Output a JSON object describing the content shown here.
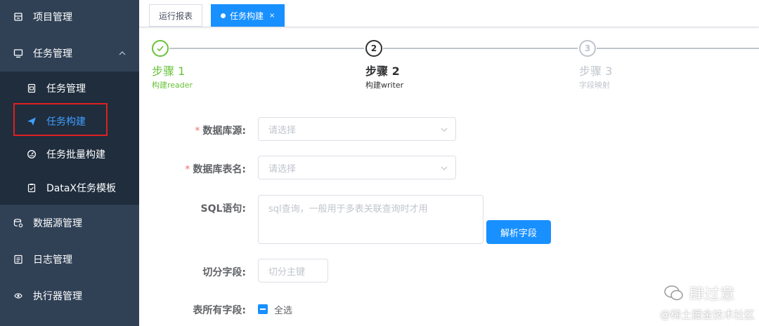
{
  "sidebar": {
    "items": [
      {
        "label": "项目管理",
        "icon": "project-icon"
      },
      {
        "label": "任务管理",
        "icon": "monitor-icon"
      },
      {
        "label": "数据源管理",
        "icon": "database-icon"
      },
      {
        "label": "日志管理",
        "icon": "log-icon"
      },
      {
        "label": "执行器管理",
        "icon": "executor-icon"
      }
    ],
    "sub_items": [
      {
        "label": "任务管理",
        "icon": "task-icon"
      },
      {
        "label": "任务构建",
        "icon": "send-icon"
      },
      {
        "label": "任务批量构建",
        "icon": "batch-icon"
      },
      {
        "label": "DataX任务模板",
        "icon": "template-icon"
      }
    ],
    "colors": {
      "bg": "#304156",
      "sub_bg": "#1f2d3d",
      "active": "#409eff",
      "highlight": "#e02020"
    }
  },
  "tabs": [
    {
      "label": "运行报表"
    },
    {
      "label": "任务构建",
      "close": "×"
    }
  ],
  "steps": [
    {
      "title": "步骤 1",
      "desc": "构建reader",
      "status": "done"
    },
    {
      "title": "步骤 2",
      "desc": "构建writer",
      "status": "process",
      "number": "2"
    },
    {
      "title": "步骤 3",
      "desc": "字段映射",
      "status": "wait",
      "number": "3"
    }
  ],
  "form": {
    "datasource": {
      "label": "数据库源:",
      "placeholder": "请选择"
    },
    "table": {
      "label": "数据库表名:",
      "placeholder": "请选择"
    },
    "sql": {
      "label": "SQL语句:",
      "placeholder": "sql查询，一般用于多表关联查询时才用"
    },
    "parse_button": "解析字段",
    "split": {
      "label": "切分字段:",
      "placeholder": "切分主键"
    },
    "all_fields": {
      "label": "表所有字段:",
      "checkbox": "全选"
    }
  },
  "watermark": {
    "line1": "肆过意",
    "line2": "@稀土掘金技术社区"
  },
  "accent": "#1890ff"
}
